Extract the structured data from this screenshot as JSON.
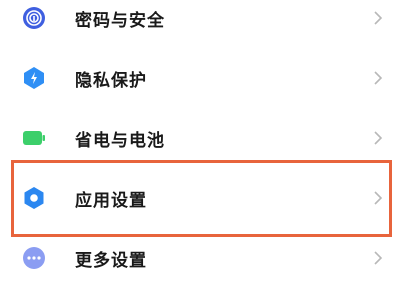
{
  "settings": {
    "items": [
      {
        "label": "密码与安全",
        "icon": "fingerprint-icon",
        "color": "#3f5fe0"
      },
      {
        "label": "隐私保护",
        "icon": "privacy-shield-icon",
        "color": "#2f8ff5"
      },
      {
        "label": "省电与电池",
        "icon": "battery-icon",
        "color": "#3ccf6a"
      },
      {
        "label": "应用设置",
        "icon": "gear-icon",
        "color": "#2b87f0"
      },
      {
        "label": "更多设置",
        "icon": "more-dots-icon",
        "color": "#8b9df2"
      }
    ]
  },
  "highlight": {
    "color": "#e8643c",
    "target": "应用设置"
  }
}
